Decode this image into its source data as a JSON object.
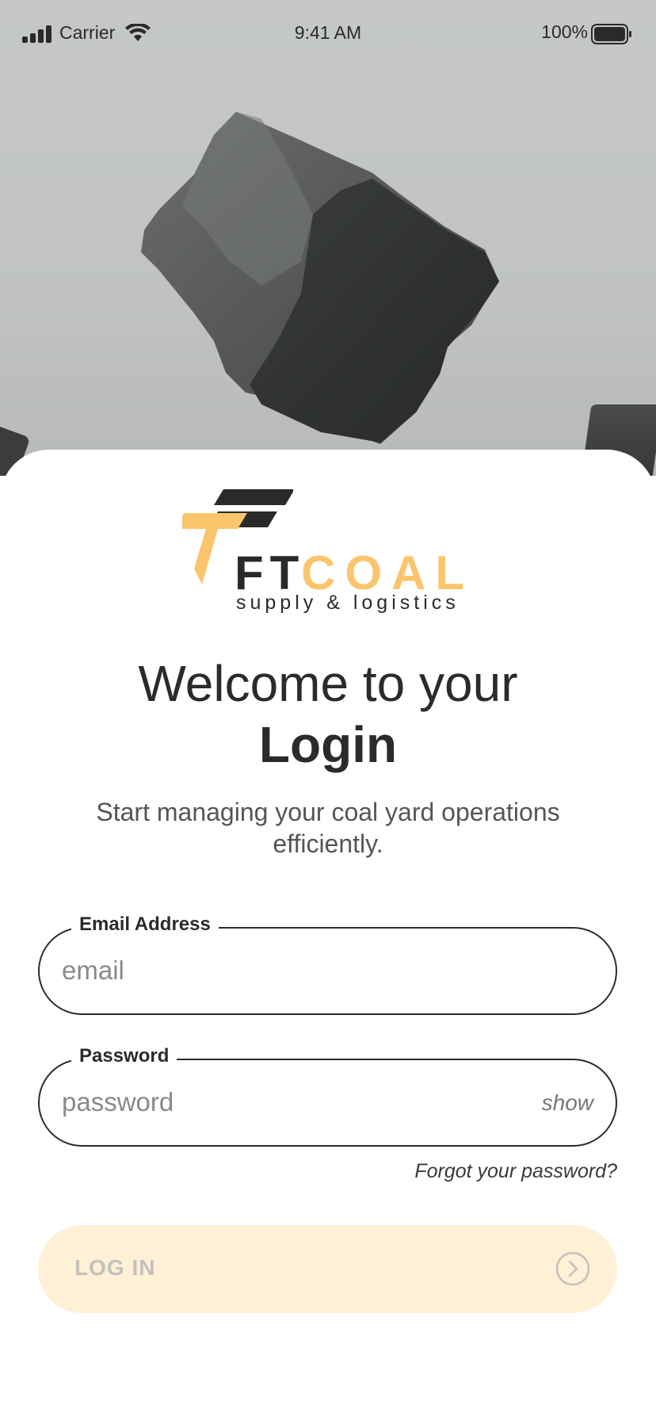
{
  "status_bar": {
    "carrier": "Carrier",
    "time": "9:41 AM",
    "battery_percent": "100%",
    "icons": [
      "cellular-signal-icon",
      "wifi-icon",
      "battery-icon"
    ]
  },
  "hero": {
    "image": "coal-lump-photo",
    "background_color": "#c3c6c3"
  },
  "logo": {
    "mark": "ft-coal-logo-mark",
    "word_ft": "FT",
    "word_coal": "COAL",
    "tagline": "supply & logistics",
    "colors": {
      "dark": "#2a2a2a",
      "accent": "#fbc56c"
    }
  },
  "welcome": {
    "line1": "Welcome to your",
    "line2": "Login",
    "subtitle": "Start managing your coal yard operations efficiently."
  },
  "form": {
    "email": {
      "label": "Email Address",
      "placeholder": "email",
      "value": ""
    },
    "password": {
      "label": "Password",
      "placeholder": "password",
      "value": "",
      "toggle_label": "show"
    },
    "forgot_link": "Forgot your password?"
  },
  "login_button": {
    "label": "LOG IN",
    "icon": "chevron-right-circle-icon",
    "state": "disabled",
    "background_color": "#fff0d6"
  }
}
